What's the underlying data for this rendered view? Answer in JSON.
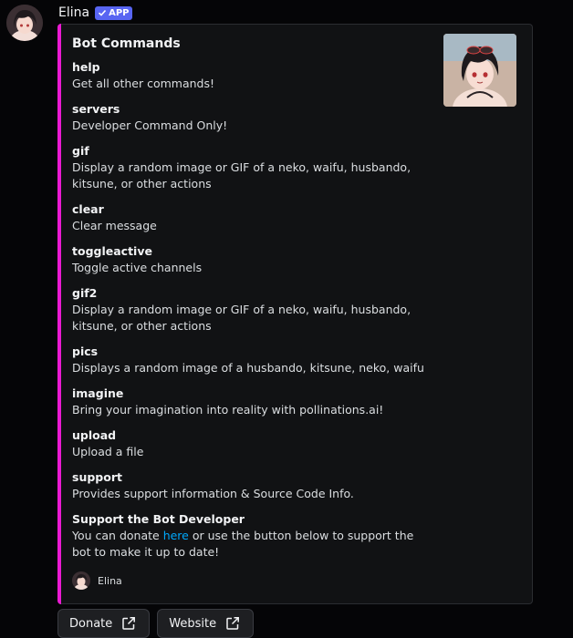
{
  "message": {
    "username": "Elina",
    "badge_label": "APP"
  },
  "embed": {
    "accent_color": "#eb1ad3",
    "title": "Bot Commands",
    "fields": [
      {
        "name": "help",
        "value": "Get all other commands!"
      },
      {
        "name": "servers",
        "value": "Developer Command Only!"
      },
      {
        "name": "gif",
        "value": "Display a random image or GIF of a neko, waifu, husbando, kitsune, or other actions"
      },
      {
        "name": "clear",
        "value": "Clear message"
      },
      {
        "name": "toggleactive",
        "value": "Toggle active channels"
      },
      {
        "name": "gif2",
        "value": "Display a random image or GIF of a neko, waifu, husbando, kitsune, or other actions"
      },
      {
        "name": "pics",
        "value": "Displays a random image of a husbando, kitsune, neko, waifu"
      },
      {
        "name": "imagine",
        "value": "Bring your imagination into reality with pollinations.ai!"
      },
      {
        "name": "upload",
        "value": "Upload a file"
      },
      {
        "name": "support",
        "value": "Provides support information & Source Code Info."
      }
    ],
    "support_field": {
      "name": "Support the Bot Developer",
      "value_before": "You can donate ",
      "link_text": "here",
      "value_after": " or use the button below to support the bot to make it up to date!"
    },
    "footer_text": "Elina"
  },
  "buttons": [
    {
      "label": "Donate",
      "icon": "external-link-icon"
    },
    {
      "label": "Website",
      "icon": "external-link-icon"
    }
  ]
}
